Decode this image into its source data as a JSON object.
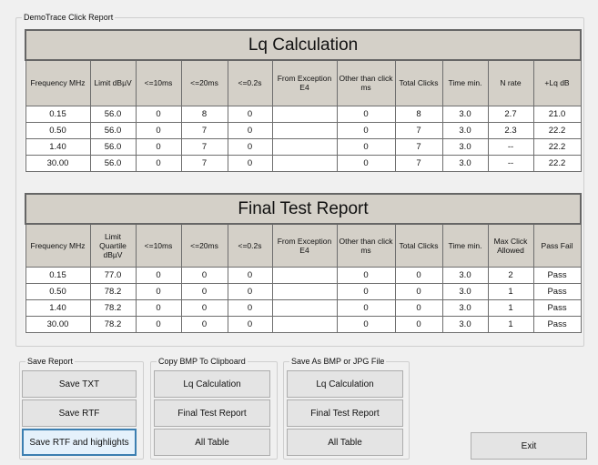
{
  "window": {
    "title": "DemoTrace Click Report"
  },
  "lq_table": {
    "title": "Lq Calculation",
    "headers": [
      "Frequency MHz",
      "Limit dBµV",
      "<=10ms",
      "<=20ms",
      "<=0.2s",
      "From Exception E4",
      "Other than click ms",
      "Total Clicks",
      "Time min.",
      "N rate",
      "+Lq dB"
    ],
    "rows": [
      [
        "0.15",
        "56.0",
        "0",
        "8",
        "0",
        "",
        "0",
        "8",
        "3.0",
        "2.7",
        "21.0"
      ],
      [
        "0.50",
        "56.0",
        "0",
        "7",
        "0",
        "",
        "0",
        "7",
        "3.0",
        "2.3",
        "22.2"
      ],
      [
        "1.40",
        "56.0",
        "0",
        "7",
        "0",
        "",
        "0",
        "7",
        "3.0",
        "--",
        "22.2"
      ],
      [
        "30.00",
        "56.0",
        "0",
        "7",
        "0",
        "",
        "0",
        "7",
        "3.0",
        "--",
        "22.2"
      ]
    ]
  },
  "final_table": {
    "title": "Final Test Report",
    "headers": [
      "Frequency MHz",
      "Limit Quartile dBµV",
      "<=10ms",
      "<=20ms",
      "<=0.2s",
      "From Exception E4",
      "Other than click ms",
      "Total Clicks",
      "Time min.",
      "Max Click Allowed",
      "Pass Fail"
    ],
    "rows": [
      [
        "0.15",
        "77.0",
        "0",
        "0",
        "0",
        "",
        "0",
        "0",
        "3.0",
        "2",
        "Pass"
      ],
      [
        "0.50",
        "78.2",
        "0",
        "0",
        "0",
        "",
        "0",
        "0",
        "3.0",
        "1",
        "Pass"
      ],
      [
        "1.40",
        "78.2",
        "0",
        "0",
        "0",
        "",
        "0",
        "0",
        "3.0",
        "1",
        "Pass"
      ],
      [
        "30.00",
        "78.2",
        "0",
        "0",
        "0",
        "",
        "0",
        "0",
        "3.0",
        "1",
        "Pass"
      ]
    ]
  },
  "save_report": {
    "title": "Save Report",
    "buttons": [
      "Save TXT",
      "Save RTF",
      "Save RTF and highlights"
    ]
  },
  "copy_bmp": {
    "title": "Copy BMP To Clipboard",
    "buttons": [
      "Lq Calculation",
      "Final Test Report",
      "All Table"
    ]
  },
  "save_as": {
    "title": "Save As BMP or JPG File",
    "buttons": [
      "Lq Calculation",
      "Final Test Report",
      "All Table"
    ]
  },
  "exit_label": "Exit"
}
